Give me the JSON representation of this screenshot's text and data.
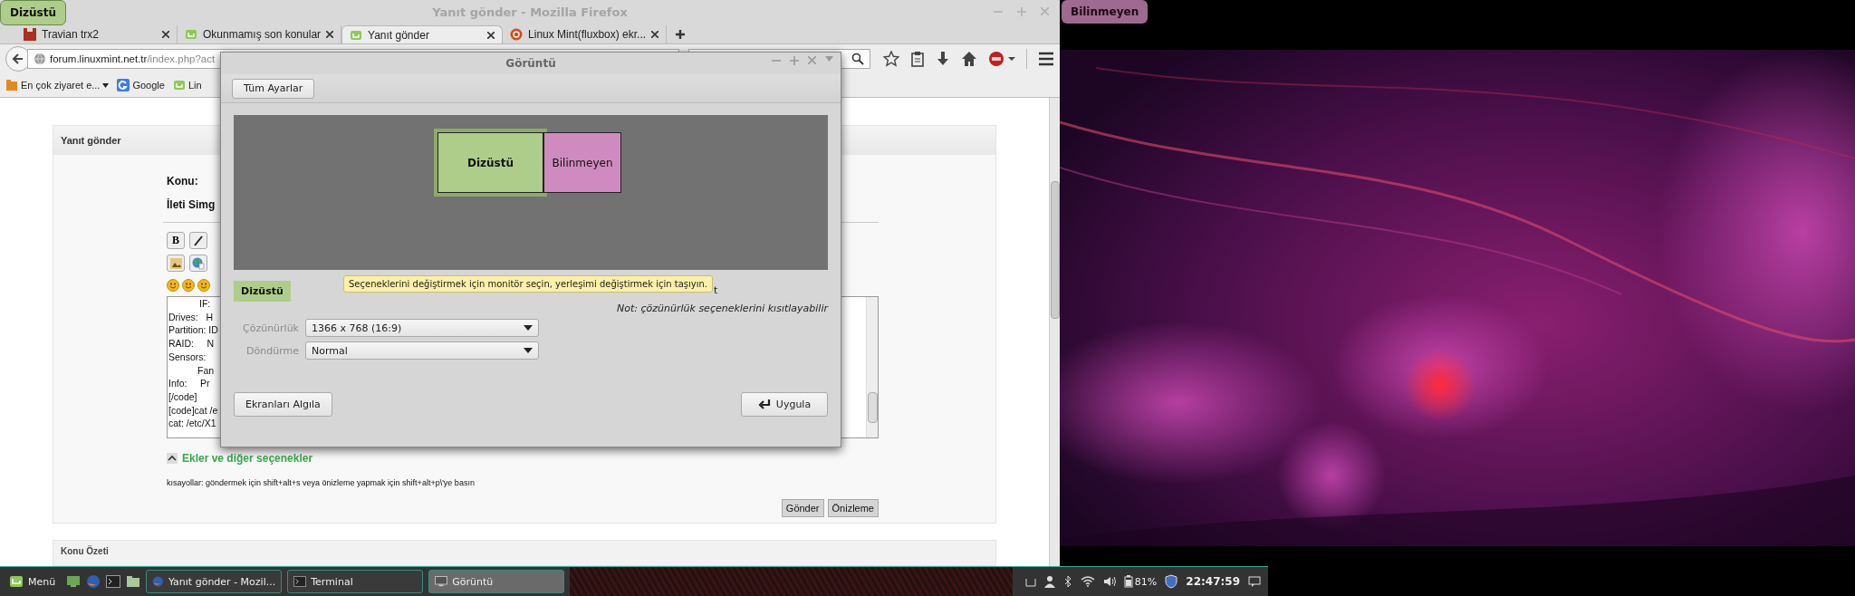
{
  "firefox": {
    "title": "Yanıt gönder - Mozilla Firefox",
    "tabs": [
      {
        "label": "Travian trx2",
        "kind": "grid",
        "selected": false
      },
      {
        "label": "Okunmamış son konular",
        "kind": "leaf",
        "selected": false
      },
      {
        "label": "Yanıt gönder",
        "kind": "leaf",
        "selected": true
      },
      {
        "label": "Linux Mint(fluxbox) ekr...",
        "kind": "ring",
        "selected": false
      }
    ],
    "url_host": "forum.linuxmint.net.tr",
    "url_path": "/index.php?act",
    "bookmarks": [
      {
        "label": "En çok ziyaret e...",
        "kind": "folder"
      },
      {
        "label": "Google",
        "kind": "g"
      },
      {
        "label": "Lin",
        "kind": "leaf"
      }
    ],
    "page": {
      "panel_title": "Yanıt gönder",
      "subject_label": "Konu:",
      "icon_label": "İleti Simg",
      "bold_button": "B",
      "editor_lines": [
        "IF:",
        "Drives:   H",
        "Partition: ID",
        "RAID:     N",
        "Sensors:",
        "Fan",
        "Info:     Pr",
        "[/code]",
        "[code]cat /e",
        "cat: /etc/X1"
      ],
      "attachments_link": "Ekler ve diğer seçenekler",
      "shortcuts": "kısayollar: göndermek için shift+alt+s veya önizleme yapmak için shift+alt+p\\'ye basın",
      "buttons": [
        "Gönder",
        "Önizleme"
      ],
      "summary_title": "Konu Özeti"
    }
  },
  "dialog": {
    "title": "Görüntü",
    "all_settings": "Tüm Ayarlar",
    "monitors": [
      {
        "name": "Dizüstü",
        "color": "#aecd8a",
        "selected": true
      },
      {
        "name": "Bilinmeyen",
        "color": "#cf8bbf",
        "selected": false
      }
    ],
    "selected_label": "Dizüstü",
    "tooltip": "Seçeneklerini değiştirmek için monitör seçin, yerleşimi değiştirmek için taşıyın.",
    "hidden_fragment": "t",
    "note": "Not: çözünürlük seçeneklerini kısıtlayabilir",
    "settings": [
      {
        "label": "Çözünürlük",
        "value": "1366 x 768 (16:9)"
      },
      {
        "label": "Döndürme",
        "value": "Normal"
      }
    ],
    "detect": "Ekranları Algıla",
    "apply": "Uygula"
  },
  "screen_labels": [
    {
      "name": "Dizüstü",
      "color": "#aecd8a"
    },
    {
      "name": "Bilinmeyen",
      "color": "#9e6a8f"
    }
  ],
  "taskbar": {
    "menu": "Menü",
    "windows": [
      {
        "label": "Yanıt gönder - Mozil...",
        "selected": false
      },
      {
        "label": "Terminal",
        "selected": false
      },
      {
        "label": "Görüntü",
        "selected": true
      }
    ],
    "battery": "81%",
    "clock": "22:47:59"
  }
}
